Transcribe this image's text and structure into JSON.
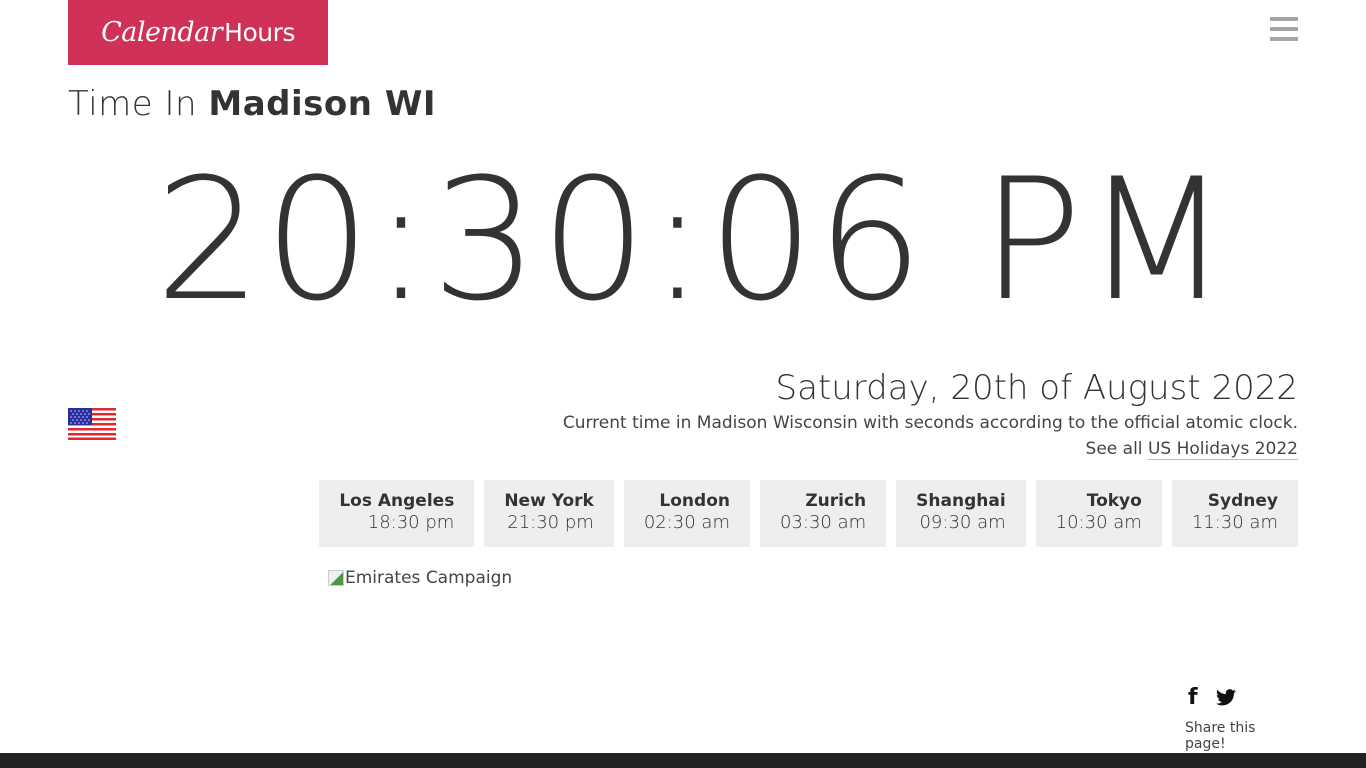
{
  "brand": {
    "part1": "Calendar",
    "part2": "Hours",
    "color": "#d03157"
  },
  "menu": {
    "icon": "hamburger-menu-icon"
  },
  "header": {
    "prefix": "Time In",
    "location": "Madison WI"
  },
  "clock": {
    "time": "20:30:06 PM"
  },
  "flag": {
    "icon": "us-flag-icon",
    "country": "US"
  },
  "date": {
    "full": "Saturday, 20th of August 2022",
    "description": "Current time in Madison Wisconsin with seconds according to the official atomic clock.",
    "holidays_prefix": "See all",
    "holidays_link": "US Holidays 2022"
  },
  "cities": [
    {
      "name": "Los Angeles",
      "time": "18:30 pm"
    },
    {
      "name": "New York",
      "time": "21:30 pm"
    },
    {
      "name": "London",
      "time": "02:30 am"
    },
    {
      "name": "Zurich",
      "time": "03:30 am"
    },
    {
      "name": "Shanghai",
      "time": "09:30 am"
    },
    {
      "name": "Tokyo",
      "time": "10:30 am"
    },
    {
      "name": "Sydney",
      "time": "11:30 am"
    }
  ],
  "ad": {
    "alt": "Emirates Campaign"
  },
  "share": {
    "facebook_glyph": "f",
    "twitter_glyph": "🐦",
    "label": "Share this page!"
  }
}
